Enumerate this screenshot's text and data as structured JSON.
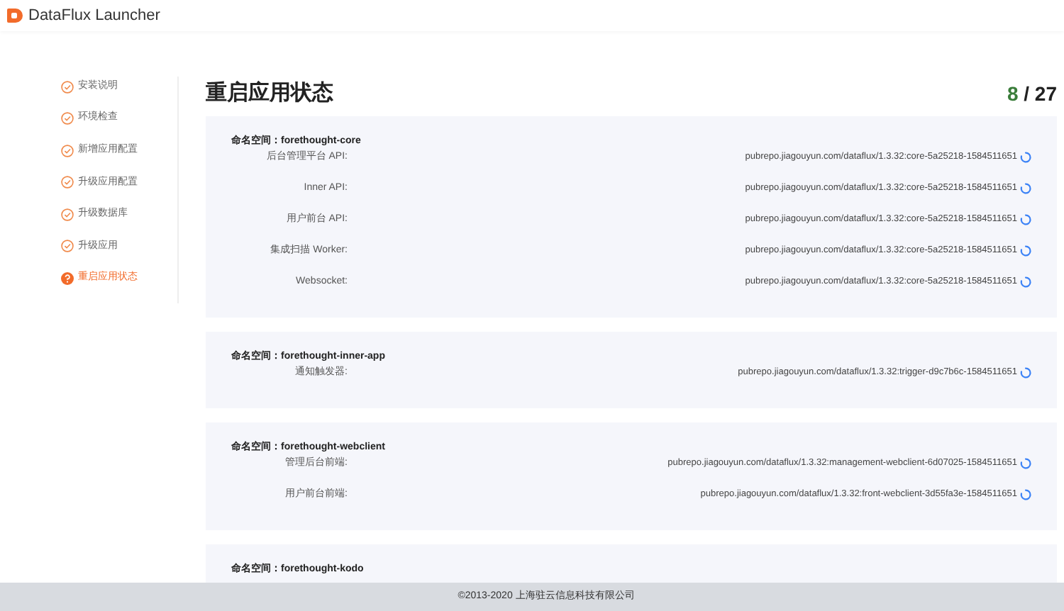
{
  "app": {
    "title": "DataFlux Launcher"
  },
  "steps": [
    {
      "label": "安装说明",
      "selected": false
    },
    {
      "label": "环境检查",
      "selected": false
    },
    {
      "label": "新增应用配置",
      "selected": false
    },
    {
      "label": "升级应用配置",
      "selected": false
    },
    {
      "label": "升级数据库",
      "selected": false
    },
    {
      "label": "升级应用",
      "selected": false
    },
    {
      "label": "重启应用状态",
      "selected": true
    }
  ],
  "page": {
    "title": "重启应用状态",
    "progress_done": "8",
    "progress_sep": "/",
    "progress_total": "27"
  },
  "namespaces": [
    {
      "label": "命名空间：",
      "name": "forethought-core",
      "services": [
        {
          "label": "后台管理平台 API:",
          "image": "pubrepo.jiagouyun.com/dataflux/1.3.32:core-5a25218-1584511651"
        },
        {
          "label": "Inner API:",
          "image": "pubrepo.jiagouyun.com/dataflux/1.3.32:core-5a25218-1584511651"
        },
        {
          "label": "用户前台 API:",
          "image": "pubrepo.jiagouyun.com/dataflux/1.3.32:core-5a25218-1584511651"
        },
        {
          "label": "集成扫描 Worker:",
          "image": "pubrepo.jiagouyun.com/dataflux/1.3.32:core-5a25218-1584511651"
        },
        {
          "label": "Websocket:",
          "image": "pubrepo.jiagouyun.com/dataflux/1.3.32:core-5a25218-1584511651"
        }
      ]
    },
    {
      "label": "命名空间：",
      "name": "forethought-inner-app",
      "services": [
        {
          "label": "通知触发器:",
          "image": "pubrepo.jiagouyun.com/dataflux/1.3.32:trigger-d9c7b6c-1584511651"
        }
      ]
    },
    {
      "label": "命名空间：",
      "name": "forethought-webclient",
      "services": [
        {
          "label": "管理后台前端:",
          "image": "pubrepo.jiagouyun.com/dataflux/1.3.32:management-webclient-6d07025-1584511651"
        },
        {
          "label": "用户前台前端:",
          "image": "pubrepo.jiagouyun.com/dataflux/1.3.32:front-webclient-3d55fa3e-1584511651"
        }
      ]
    },
    {
      "label": "命名空间：",
      "name": "forethought-kodo"
    }
  ],
  "footer": {
    "copyright": "©2013-2020 上海驻云信息科技有限公司"
  }
}
